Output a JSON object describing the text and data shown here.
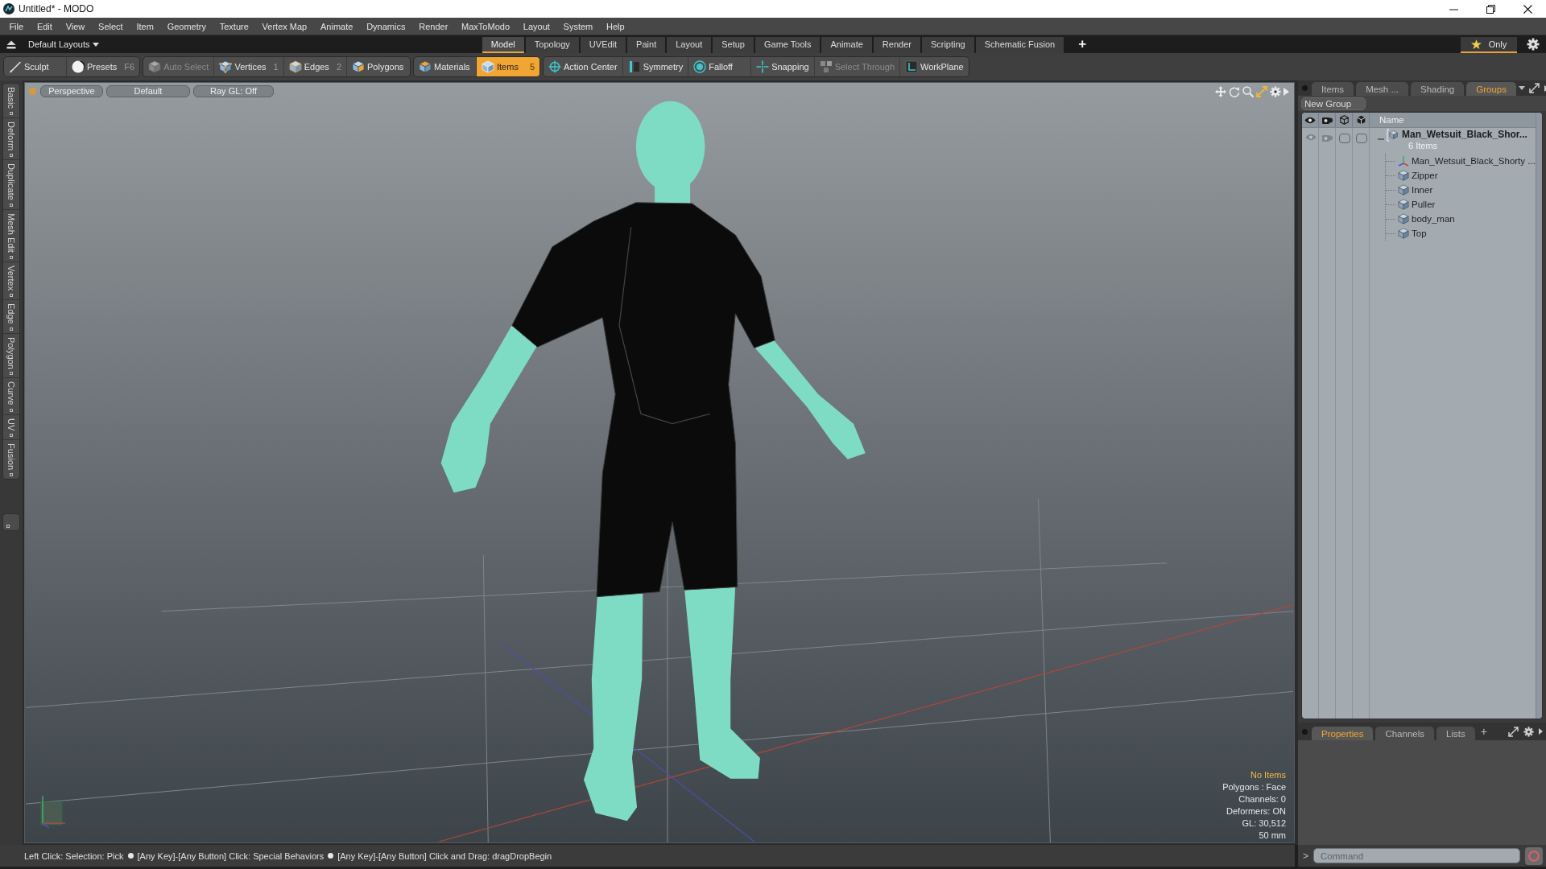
{
  "window": {
    "title": "Untitled* - MODO"
  },
  "menu_bar": [
    "File",
    "Edit",
    "View",
    "Select",
    "Item",
    "Geometry",
    "Texture",
    "Vertex Map",
    "Animate",
    "Dynamics",
    "Render",
    "MaxToModo",
    "Layout",
    "System",
    "Help"
  ],
  "layout_bar": {
    "layouts_menu": "Default Layouts",
    "tabs": [
      {
        "label": "Model",
        "selected": true
      },
      {
        "label": "Topology",
        "selected": false
      },
      {
        "label": "UVEdit",
        "selected": false
      },
      {
        "label": "Paint",
        "selected": false
      },
      {
        "label": "Layout",
        "selected": false
      },
      {
        "label": "Setup",
        "selected": false
      },
      {
        "label": "Game Tools",
        "selected": false
      },
      {
        "label": "Animate",
        "selected": false
      },
      {
        "label": "Render",
        "selected": false
      },
      {
        "label": "Scripting",
        "selected": false
      },
      {
        "label": "Schematic Fusion",
        "selected": false
      }
    ],
    "add_tab": "+",
    "only_filter": {
      "label": "Only",
      "on": true
    }
  },
  "toolbar": [
    {
      "items": [
        {
          "label": "Sculpt",
          "kind": "brush",
          "disabled": false,
          "selected": false
        },
        {
          "label": "Presets",
          "shortcut": "F6",
          "kind": "ball",
          "disabled": false,
          "selected": false
        }
      ]
    },
    {
      "items": [
        {
          "label": "Auto Select",
          "kind": "ghostcube",
          "disabled": true,
          "selected": false
        },
        {
          "label": "Vertices",
          "shortcut": "1",
          "kind": "vertexcube",
          "disabled": false,
          "selected": false
        },
        {
          "label": "Edges",
          "shortcut": "2",
          "kind": "edgecube",
          "disabled": false,
          "selected": false
        },
        {
          "label": "Polygons",
          "kind": "facecube",
          "disabled": false,
          "selected": false
        }
      ]
    },
    {
      "items": [
        {
          "label": "Materials",
          "kind": "materialcube",
          "disabled": false,
          "selected": false
        },
        {
          "label": "Items",
          "shortcut": "5",
          "kind": "itemcube",
          "disabled": false,
          "selected": true
        }
      ]
    },
    {
      "items": [
        {
          "label": "Action Center",
          "kind": "target",
          "disabled": false,
          "selected": false
        },
        {
          "label": "Symmetry",
          "kind": "mirror",
          "disabled": false,
          "selected": false
        },
        {
          "label": "Falloff",
          "kind": "rings",
          "disabled": false,
          "selected": false
        },
        {
          "label": "Snapping",
          "kind": "cross",
          "disabled": false,
          "selected": false
        },
        {
          "label": "Select Through",
          "kind": "through",
          "disabled": true,
          "selected": false
        },
        {
          "label": "WorkPlane",
          "kind": "plane",
          "disabled": false,
          "selected": false
        }
      ]
    }
  ],
  "tool_tabs": [
    "Basic",
    "Deform",
    "Duplicate",
    "Mesh Edit",
    "Vertex",
    "Edge",
    "Polygon",
    "Curve",
    "UV",
    "Fusion"
  ],
  "viewport": {
    "buttons": [
      "Perspective",
      "Default",
      "Ray GL: Off"
    ],
    "info": [
      {
        "text": "No Items",
        "kind": "highlight"
      },
      {
        "text": "Polygons : Face",
        "kind": "plain"
      },
      {
        "text": "Channels: 0",
        "kind": "plain"
      },
      {
        "text": "Deformers: ON",
        "kind": "plain"
      },
      {
        "text": "GL: 30,512",
        "kind": "plain"
      },
      {
        "text": "50 mm",
        "kind": "plain"
      }
    ]
  },
  "groups_panel": {
    "tabs": [
      {
        "label": "Items",
        "selected": false
      },
      {
        "label": "Mesh ...",
        "selected": false
      },
      {
        "label": "Shading",
        "selected": false
      },
      {
        "label": "Groups",
        "selected": true
      }
    ],
    "new_group": "New Group",
    "name_column": "Name",
    "groups": [
      {
        "name": "Man_Wetsuit_Black_Shor...",
        "count": "6 Items",
        "expanded": true,
        "children": [
          {
            "name": "Man_Wetsuit_Black_Shorty ...",
            "kind": "locator"
          },
          {
            "name": "Zipper",
            "kind": "mesh"
          },
          {
            "name": "Inner",
            "kind": "mesh"
          },
          {
            "name": "Puller",
            "kind": "mesh"
          },
          {
            "name": "body_man",
            "kind": "mesh"
          },
          {
            "name": "Top",
            "kind": "mesh"
          }
        ]
      }
    ]
  },
  "properties_panel": {
    "tabs": [
      {
        "label": "Properties",
        "selected": true
      },
      {
        "label": "Channels",
        "selected": false
      },
      {
        "label": "Lists",
        "selected": false
      }
    ],
    "add_tab": "+"
  },
  "command_line": {
    "prompt": ">",
    "placeholder": "Command"
  },
  "status_bar": [
    "Left Click: Selection: Pick",
    "[Any Key]-[Any Button] Click: Special Behaviors",
    "[Any Key]-[Any Button] Click and Drag: dragDropBegin"
  ]
}
